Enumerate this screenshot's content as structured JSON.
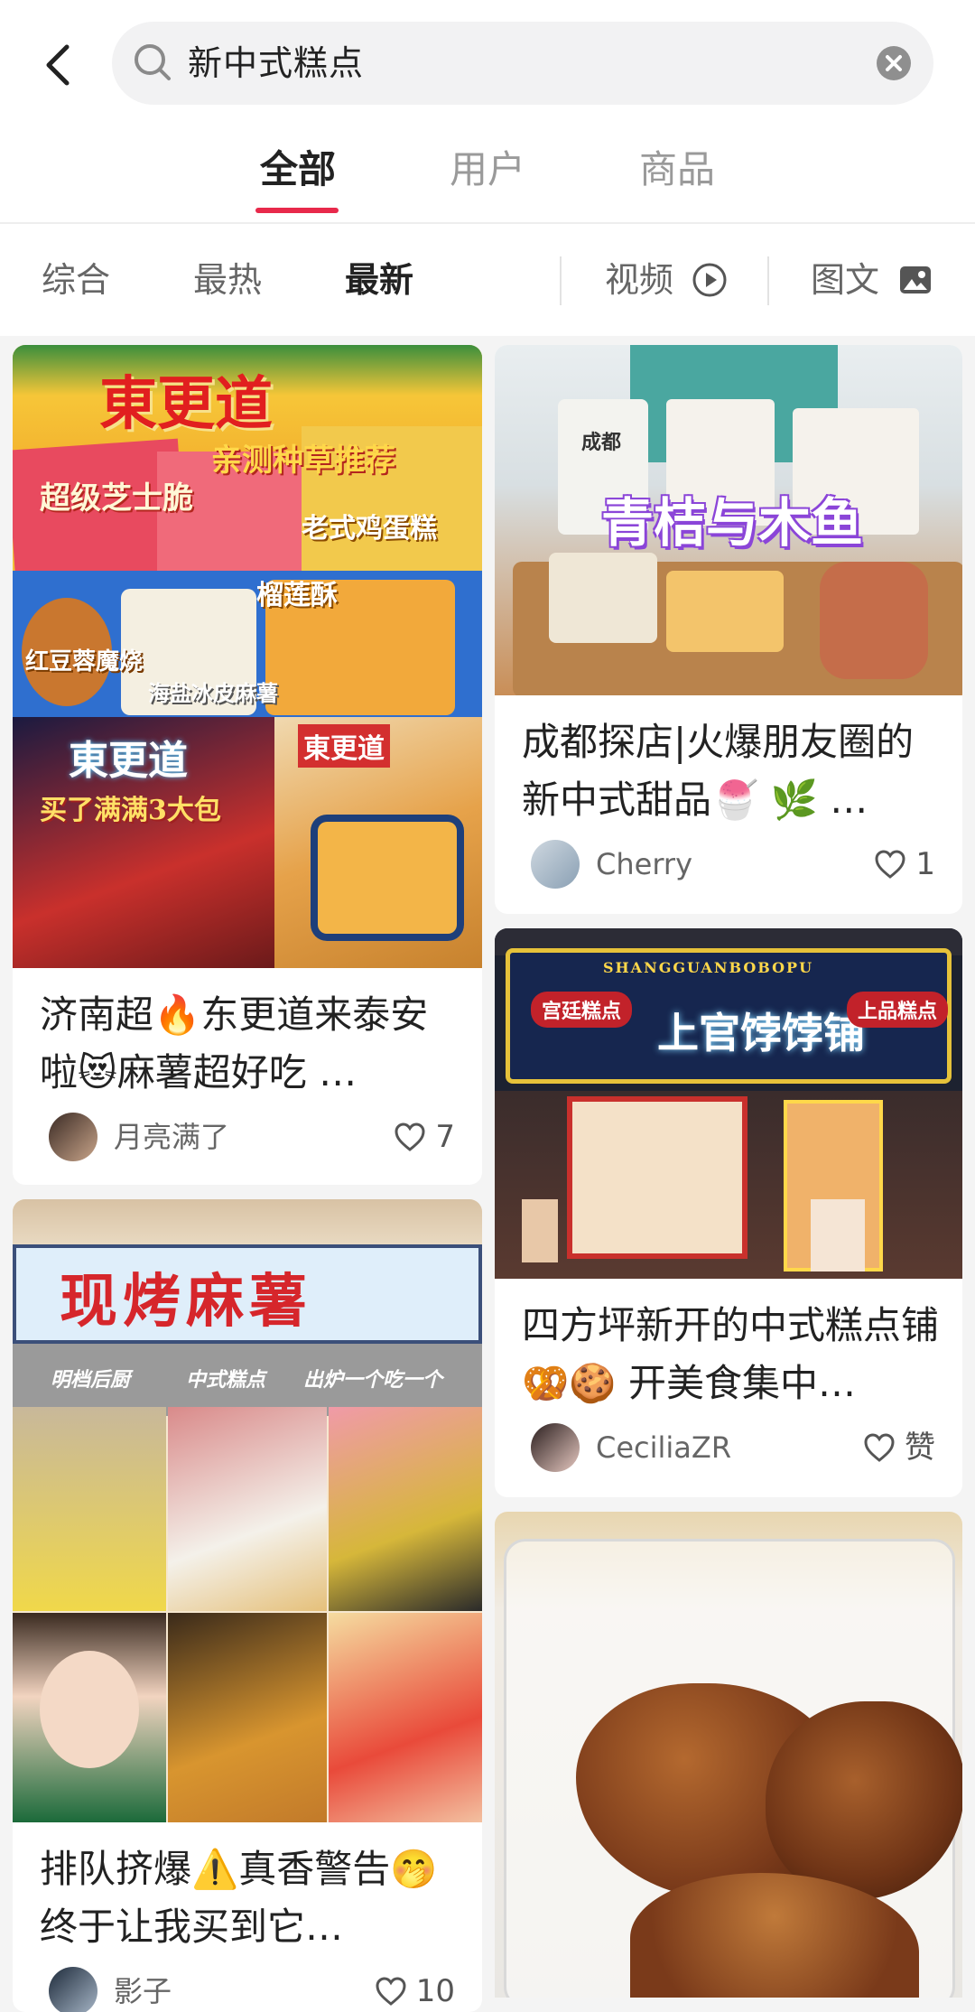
{
  "search": {
    "query": "新中式糕点"
  },
  "tabs": [
    {
      "label": "全部",
      "active": true
    },
    {
      "label": "用户",
      "active": false
    },
    {
      "label": "商品",
      "active": false
    }
  ],
  "filters": {
    "sort": [
      {
        "label": "综合",
        "active": false
      },
      {
        "label": "最热",
        "active": false
      },
      {
        "label": "最新",
        "active": true
      }
    ],
    "video_label": "视频",
    "image_text_label": "图文"
  },
  "colors": {
    "accent": "#e8294b"
  },
  "feed": {
    "left": [
      {
        "title": "济南超🔥东更道来泰安啦😻麻薯超好吃 …",
        "author": "月亮满了",
        "likes": "7",
        "image_text": {
          "brand": "東更道",
          "tag1": "亲测种草推荐",
          "tag2": "超级芝士脆",
          "tag3": "老式鸡蛋糕",
          "tag4": "榴莲酥",
          "tag5": "红豆蓉魔烧",
          "tag6": "海盐冰皮麻薯",
          "tag7": "买了满满3大包"
        }
      },
      {
        "title": "排队挤爆⚠️真香警告🤭终于让我买到它…",
        "author": "影子",
        "likes": "10",
        "image_text": {
          "sign": "现烤麻薯",
          "caption1": "明档后厨",
          "caption2": "中式糕点",
          "caption3": "出炉一个吃一个"
        }
      }
    ],
    "right": [
      {
        "title": "成都探店|火爆朋友圈的新中式甜品🍧 🌿 …",
        "author": "Cherry",
        "likes": "1",
        "image_text": {
          "overlay": "青桔与木鱼",
          "bag_label": "成都"
        }
      },
      {
        "title": "四方坪新开的中式糕点铺🥨🍪 开美食集中…",
        "author": "CeciliaZR",
        "likes": "赞",
        "image_text": {
          "store": "上官饽饽铺",
          "left_sign": "宫廷糕点",
          "right_sign": "上品糕点",
          "pinyin": "SHANGGUANBOBOPU"
        }
      },
      {
        "title": "",
        "author": "",
        "likes": ""
      }
    ]
  }
}
